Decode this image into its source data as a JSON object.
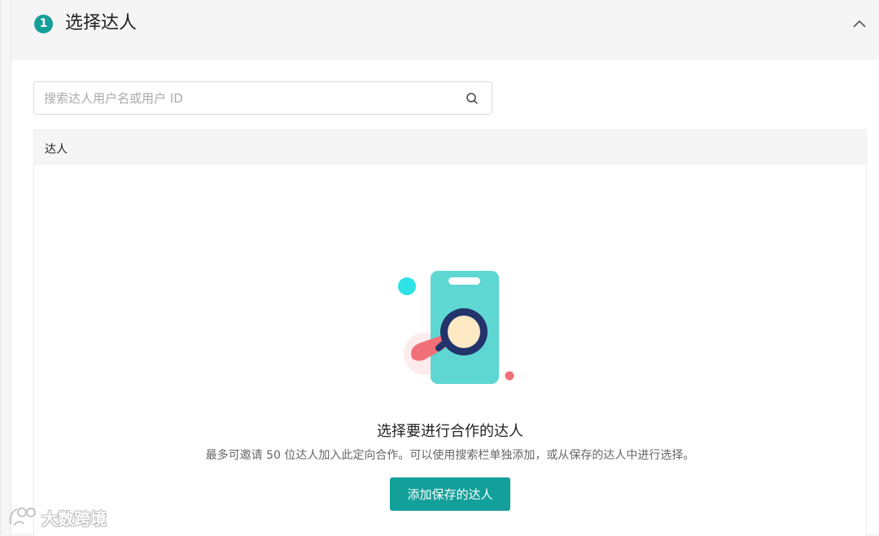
{
  "section": {
    "step_number": "1",
    "title": "选择达人"
  },
  "search": {
    "placeholder": "搜索达人用户名或用户 ID",
    "value": ""
  },
  "table": {
    "columns": [
      "达人"
    ]
  },
  "empty_state": {
    "title": "选择要进行合作的达人",
    "description": "最多可邀请 50 位达人加入此定向合作。可以使用搜索栏单独添加，或从保存的达人中进行选择。",
    "button_label": "添加保存的达人"
  },
  "watermark": {
    "text": "大数跨境"
  },
  "colors": {
    "accent": "#139f9a",
    "header_bg": "#f5f5f5",
    "illus_phone": "#5ed6d1",
    "illus_lens": "#23336b",
    "illus_coral": "#f06f78",
    "illus_cyan": "#2ee3e8"
  },
  "icons": {
    "collapse": "chevron-up-icon",
    "search": "search-icon"
  }
}
